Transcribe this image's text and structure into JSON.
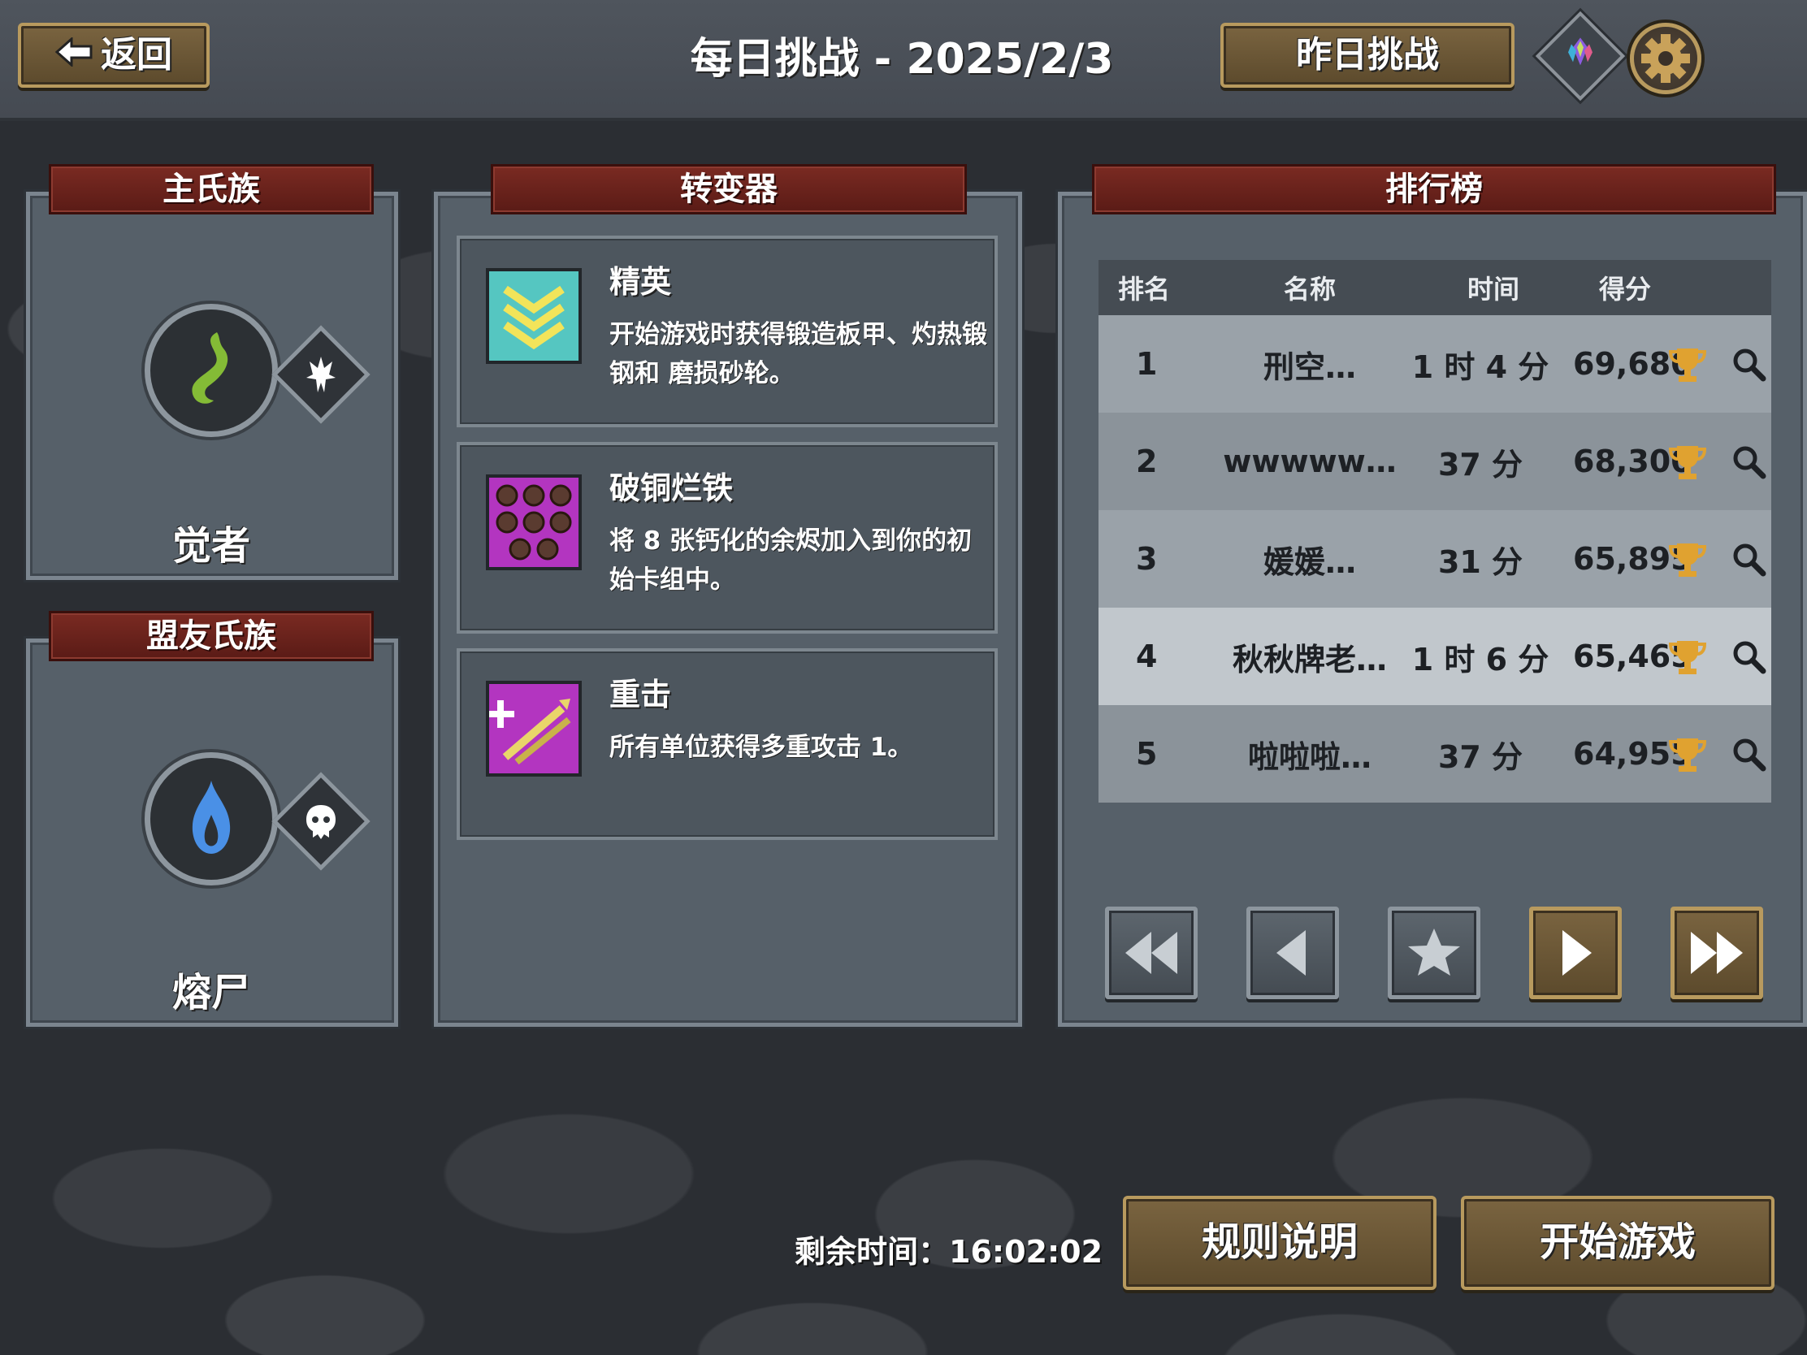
{
  "header": {
    "back_label": "返回",
    "title": "每日挑战 - 2025/2/3",
    "yesterday_label": "昨日挑战"
  },
  "primary_clan": {
    "heading": "主氏族",
    "name": "觉者",
    "icon": "green-wisp-icon",
    "sub_icon": "awoken-emblem-icon",
    "color": "#7fb534"
  },
  "allied_clan": {
    "heading": "盟友氏族",
    "name": "熔尸",
    "icon": "blue-flame-icon",
    "sub_icon": "melting-skull-icon",
    "color": "#4a8ee0"
  },
  "mutators": {
    "heading": "转变器",
    "items": [
      {
        "title": "精英",
        "desc": "开始游戏时获得锻造板甲、灼热锻钢和 磨损砂轮。",
        "icon": "chevron-rank-icon",
        "color": "#55c6c1"
      },
      {
        "title": "破铜烂铁",
        "desc": "将 8 张钙化的余烬加入到你的初始卡组中。",
        "icon": "embers-grid-icon",
        "color": "#b335c0"
      },
      {
        "title": "重击",
        "desc": "所有单位获得多重攻击 1。",
        "icon": "multistrike-icon",
        "color": "#b335c0"
      }
    ]
  },
  "leaderboard": {
    "heading": "排行榜",
    "columns": {
      "rank": "排名",
      "name": "名称",
      "time": "时间",
      "score": "得分"
    },
    "rows": [
      {
        "rank": "1",
        "name": "刑空…",
        "time": "1 时 4 分",
        "score": "69,680"
      },
      {
        "rank": "2",
        "name": "wwwww…",
        "time": "37 分",
        "score": "68,300"
      },
      {
        "rank": "3",
        "name": "媛媛…",
        "time": "31 分",
        "score": "65,895"
      },
      {
        "rank": "4",
        "name": "秋秋牌老…",
        "time": "1 时 6 分",
        "score": "65,465"
      },
      {
        "rank": "5",
        "name": "啦啦啦…",
        "time": "37 分",
        "score": "64,955"
      }
    ],
    "pager_icons": [
      "first-page-icon",
      "prev-page-icon",
      "star-icon",
      "next-page-icon",
      "last-page-icon"
    ]
  },
  "footer": {
    "remaining_label": "剩余时间：",
    "remaining_value": "16:02:02",
    "rules_label": "规则说明",
    "start_label": "开始游戏"
  }
}
